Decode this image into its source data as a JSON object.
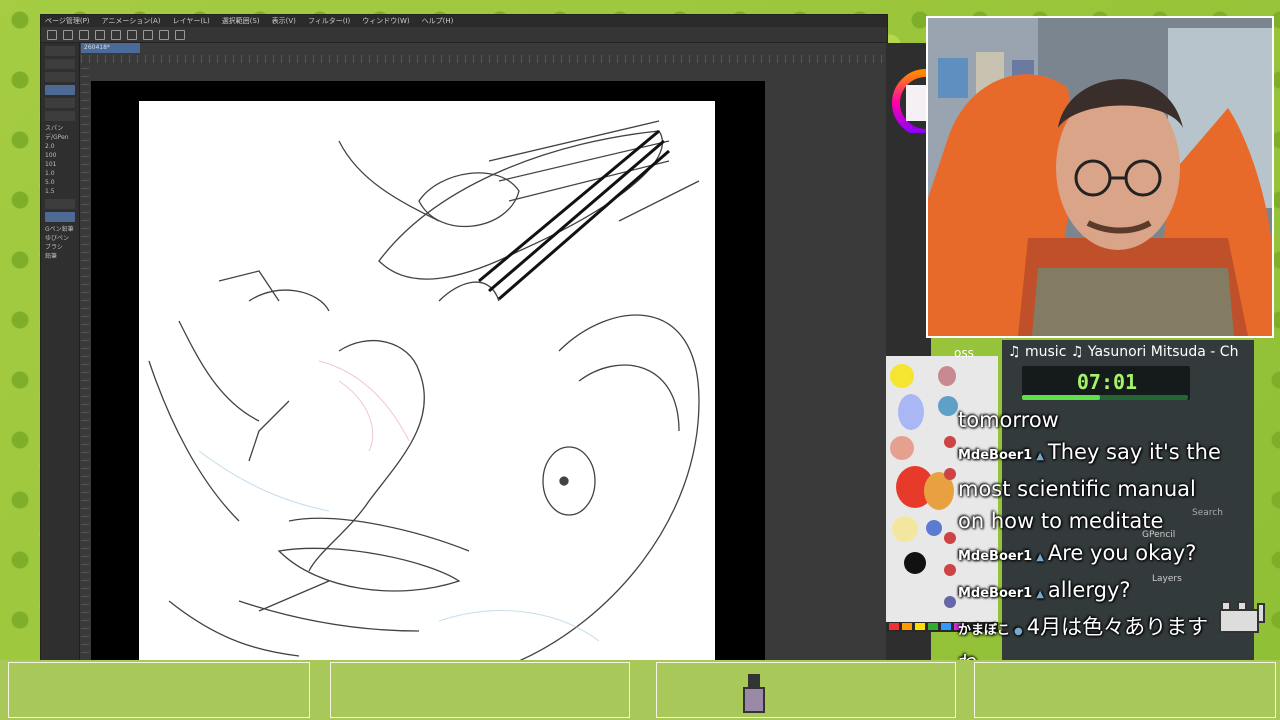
{
  "app": {
    "menu": [
      "ページ管理(P)",
      "アニメーション(A)",
      "レイヤー(L)",
      "選択範囲(S)",
      "表示(V)",
      "フィルター(I)",
      "ウィンドウ(W)",
      "ヘルプ(H)"
    ],
    "doc_tab": "260418*",
    "left_labels": [
      "スパンデ/GPen",
      "2.0",
      "100",
      "101",
      "1.0",
      "5.0",
      "1.5"
    ],
    "tool_panel_labels": [
      "Gペン鉛筆",
      "ゆびペン",
      "ブラシ",
      "鉛筆"
    ]
  },
  "stream": {
    "music": "♫ music ♫ Yasunori Mitsuda - Ch",
    "timer": "07:01",
    "progress_fraction": 0.47,
    "palette_text": "oss"
  },
  "chat": [
    {
      "user": "",
      "text": "tomorrow"
    },
    {
      "user": "MdeBoer1",
      "text": "They say it's the"
    },
    {
      "user": "",
      "text": "most scientific manual"
    },
    {
      "user": "",
      "text": "on how to meditate"
    },
    {
      "user": "MdeBoer1",
      "text": "Are you okay?"
    },
    {
      "user": "MdeBoer1",
      "text": "allergy?"
    },
    {
      "user": "かまぼこ",
      "text": "4月は色々あります"
    },
    {
      "user": "",
      "text": "ね"
    }
  ],
  "overlay_ui": {
    "search": "Search",
    "gpencil": "GPencil",
    "layers": "Layers"
  },
  "colors": {
    "accent_green": "#5fe04a",
    "timer_green": "#a6f36a",
    "bg_green": "#9cc43a"
  }
}
